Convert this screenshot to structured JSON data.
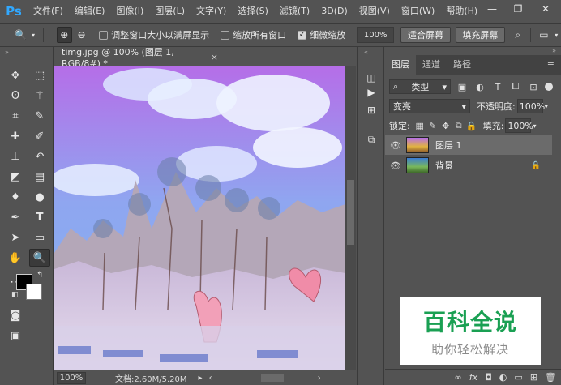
{
  "app": {
    "logo": "Ps"
  },
  "menu": [
    "文件(F)",
    "编辑(E)",
    "图像(I)",
    "图层(L)",
    "文字(Y)",
    "选择(S)",
    "滤镜(T)",
    "3D(D)",
    "视图(V)",
    "窗口(W)",
    "帮助(H)"
  ],
  "options": {
    "resize_windows_label": "调整窗口大小以满屏显示",
    "zoom_all_label": "缩放所有窗口",
    "scrubby_zoom_label": "细微缩放",
    "scrubby_zoom_checked": true,
    "zoom_value": "100%",
    "fit_screen": "适合屏幕",
    "fill_screen": "填充屏幕"
  },
  "document": {
    "tab_title": "timg.jpg @ 100% (图层 1, RGB/8#) *",
    "zoom": "100%",
    "doc_info": "文档:2.60M/5.20M"
  },
  "layers_panel": {
    "tabs": [
      "图层",
      "通道",
      "路径"
    ],
    "active_tab": "图层",
    "filter_kind": "类型",
    "blend_mode": "变亮",
    "opacity_label": "不透明度:",
    "opacity_value": "100%",
    "lock_label": "锁定:",
    "fill_label": "填充:",
    "fill_value": "100%",
    "layers": [
      {
        "name": "图层 1",
        "selected": true,
        "locked": false
      },
      {
        "name": "背景",
        "selected": false,
        "locked": true
      }
    ]
  },
  "watermark": {
    "title": "百科全说",
    "subtitle": "助你轻松解决"
  },
  "colors": {
    "ps_blue": "#31a8ff",
    "ui_bg": "#535353",
    "watermark_green": "#1aa053"
  }
}
